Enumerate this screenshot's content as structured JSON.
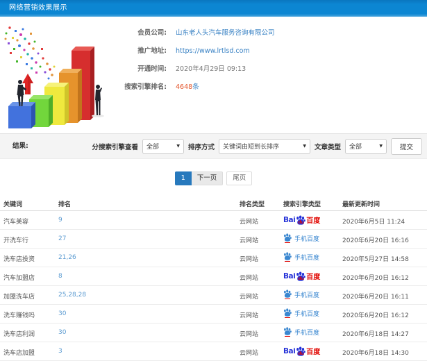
{
  "header": {
    "title": "网络营销效果展示"
  },
  "info": {
    "member_company_label": "会员公司:",
    "member_company": "山东老人头汽车服务咨询有限公司",
    "promo_url_label": "推广地址:",
    "promo_url": "https://www.lrtlsd.com",
    "open_time_label": "开通时间:",
    "open_time": "2020年4月29日 09:13",
    "rank_count_label": "搜索引擎排名:",
    "rank_count": "4648",
    "rank_count_unit": "条"
  },
  "filters": {
    "section_label": "结果:",
    "engine_filter_label": "分搜索引擎查看",
    "engine_filter_value": "全部",
    "sort_label": "排序方式",
    "sort_value": "关键词由短到长排序",
    "article_type_label": "文章类型",
    "article_type_value": "全部",
    "submit_label": "提交"
  },
  "icons": {
    "dropdown_arrow": "▼"
  },
  "pagination": {
    "current": "1",
    "next_label": "下一页",
    "last_label": "尾页"
  },
  "table": {
    "columns": [
      "关键词",
      "排名",
      "排名类型",
      "搜索引擎类型",
      "最新更新时间"
    ],
    "rows": [
      {
        "keyword": "汽车美容",
        "rank": "9",
        "rank_type": "云网站",
        "engine": "baidu",
        "updated": "2020年6月5日 11:24"
      },
      {
        "keyword": "开洗车行",
        "rank": "27",
        "rank_type": "云网站",
        "engine": "mobile_baidu",
        "updated": "2020年6月20日 16:16"
      },
      {
        "keyword": "洗车店投资",
        "rank": "21,26",
        "rank_type": "云网站",
        "engine": "mobile_baidu",
        "updated": "2020年5月27日 14:58"
      },
      {
        "keyword": "汽车加盟店",
        "rank": "8",
        "rank_type": "云网站",
        "engine": "baidu",
        "updated": "2020年6月20日 16:12"
      },
      {
        "keyword": "加盟洗车店",
        "rank": "25,28,28",
        "rank_type": "云网站",
        "engine": "mobile_baidu",
        "updated": "2020年6月20日 16:11"
      },
      {
        "keyword": "洗车赚钱吗",
        "rank": "30",
        "rank_type": "云网站",
        "engine": "mobile_baidu",
        "updated": "2020年6月20日 16:12"
      },
      {
        "keyword": "洗车店利润",
        "rank": "30",
        "rank_type": "云网站",
        "engine": "mobile_baidu",
        "updated": "2020年6月18日 14:27"
      },
      {
        "keyword": "洗车店加盟",
        "rank": "3",
        "rank_type": "云网站",
        "engine": "baidu",
        "updated": "2020年6月18日 14:30"
      }
    ]
  },
  "engine_labels": {
    "baidu": {
      "bai": "Bai",
      "du": "du",
      "baidu_cn": "百度"
    },
    "mobile_baidu": {
      "label": "手机百度"
    }
  },
  "colors": {
    "header_bg": "#0c86d2",
    "link_blue": "#3982c4",
    "rank_blue": "#5b9bd1",
    "count_red": "#e4572e",
    "baidu_blue": "#2633d8",
    "baidu_red": "#e10601",
    "mobile_baidu_blue": "#3a87d0",
    "pagination_active_bg": "#2779bd",
    "filter_bar_bg": "#f4f4f4"
  }
}
